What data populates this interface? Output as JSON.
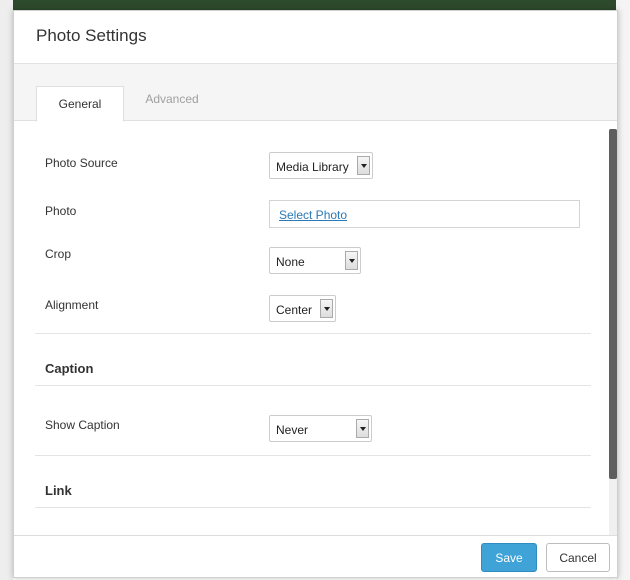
{
  "dialog": {
    "title": "Photo Settings"
  },
  "tabs": [
    {
      "label": "General",
      "active": true
    },
    {
      "label": "Advanced",
      "active": false
    }
  ],
  "fields": {
    "photo_source": {
      "label": "Photo Source",
      "value": "Media Library"
    },
    "photo": {
      "label": "Photo",
      "link_text": "Select Photo"
    },
    "crop": {
      "label": "Crop",
      "value": "None"
    },
    "alignment": {
      "label": "Alignment",
      "value": "Center"
    },
    "show_caption": {
      "label": "Show Caption",
      "value": "Never"
    }
  },
  "sections": {
    "caption": "Caption",
    "link": "Link"
  },
  "footer": {
    "save_label": "Save",
    "cancel_label": "Cancel"
  },
  "colors": {
    "primary_button": "#3fa3d8",
    "link": "#2a7ab6",
    "scrollbar_thumb": "#5e5e5e"
  }
}
